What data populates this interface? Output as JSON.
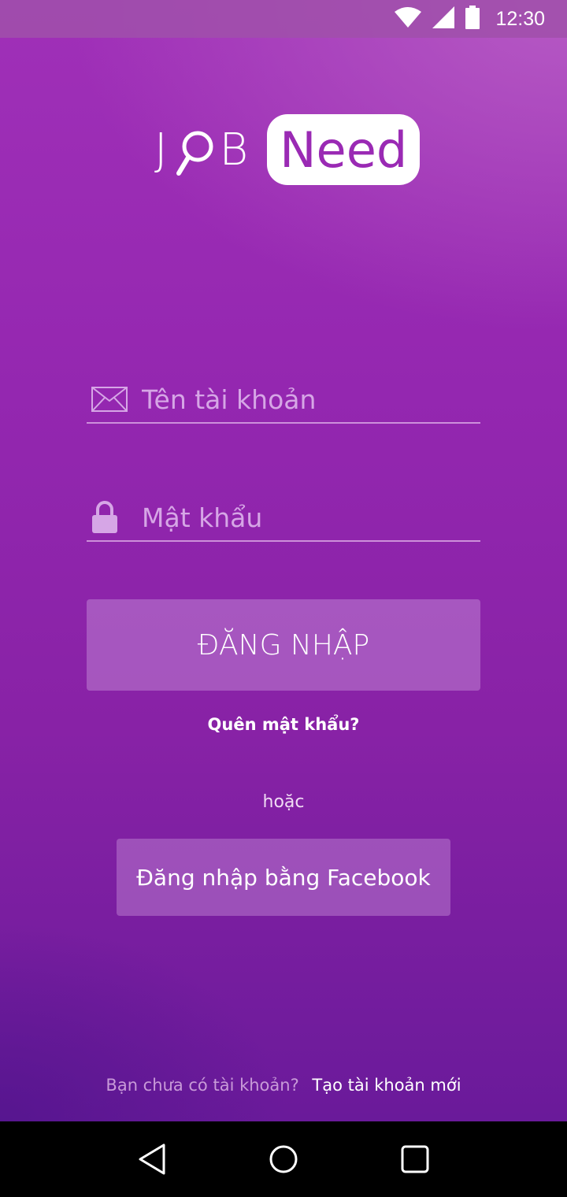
{
  "status_bar": {
    "time": "12:30",
    "icons": [
      "wifi-icon",
      "signal-icon",
      "battery-icon"
    ]
  },
  "logo": {
    "word_left_j": "J",
    "word_left_b": "B",
    "word_right": "Need"
  },
  "login_form": {
    "username_placeholder": "Tên tài khoản",
    "username_value": "",
    "password_placeholder": "Mật khẩu",
    "password_value": "",
    "login_button": "ĐĂNG NHẬP",
    "forgot_password": "Quên mật khẩu?",
    "or_separator": "hoặc",
    "facebook_button": "Đăng nhập bằng Facebook"
  },
  "signup": {
    "question": "Bạn chưa có tài khoản?",
    "link": "Tạo tài khoản mới"
  },
  "nav_bar": {
    "icons": [
      "back-icon",
      "home-icon",
      "recents-icon"
    ]
  },
  "colors": {
    "brand_purple": "#9a2ab4",
    "background_top": "#a030b8",
    "background_bottom": "#6a1a9a"
  }
}
